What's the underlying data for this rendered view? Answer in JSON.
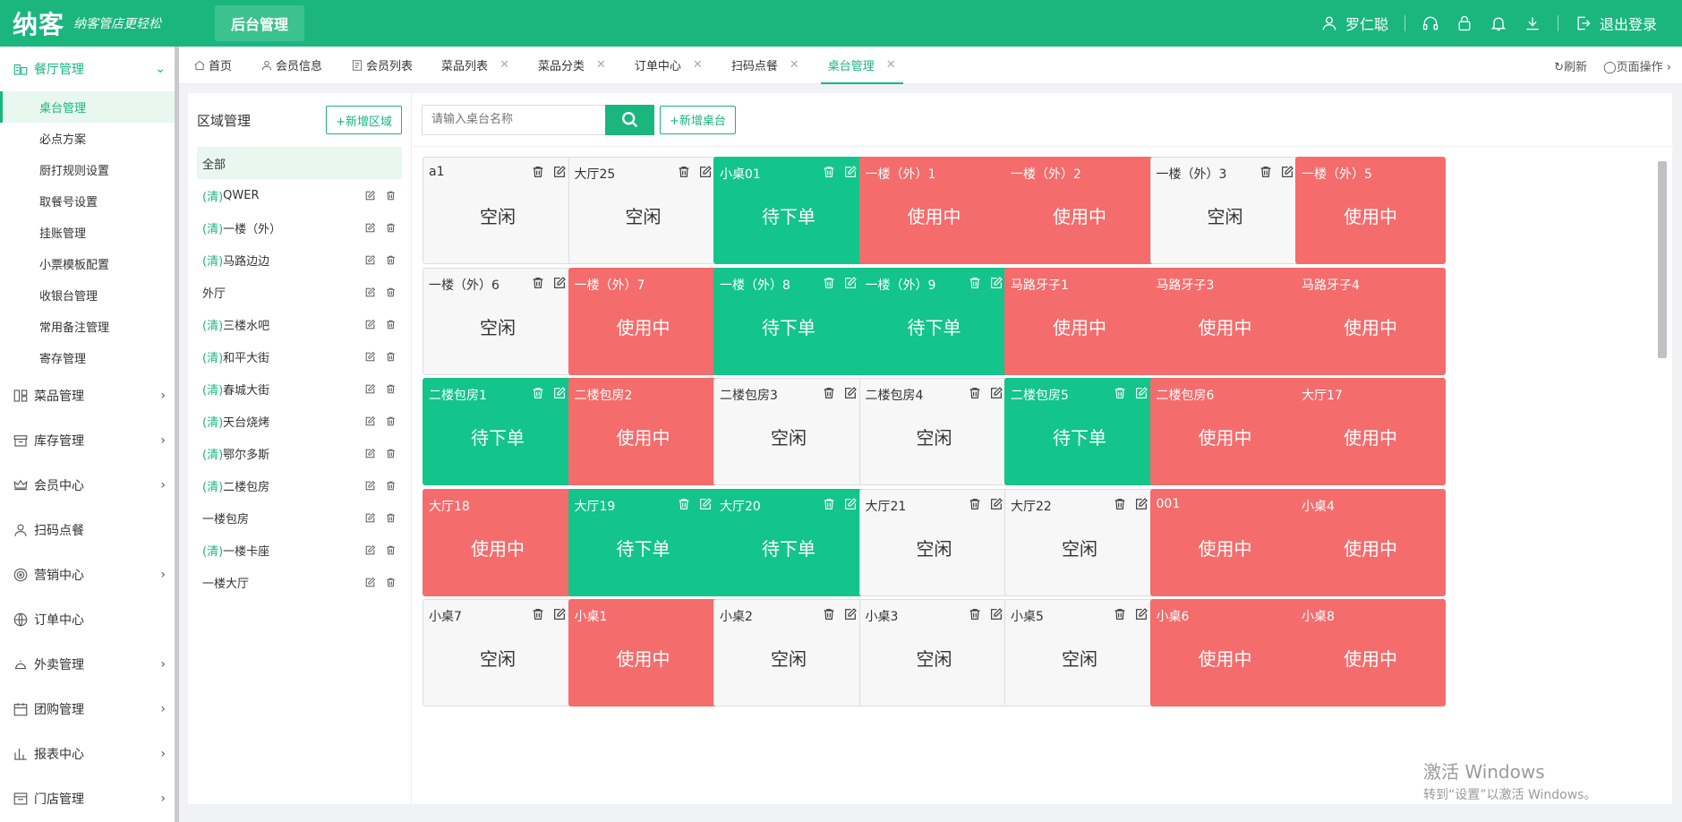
{
  "header": {
    "logo": "纳客",
    "slogan": "纳客管店更轻松",
    "active_tab": "后台管理",
    "user_name": "罗仁聪",
    "logout": "退出登录",
    "bg_color": "#1ab67e"
  },
  "sidebar": {
    "groups": [
      {
        "label": "餐厅管理",
        "icon": "restaurant-icon",
        "open": true
      },
      {
        "label": "菜品管理",
        "icon": "dish-icon"
      },
      {
        "label": "库存管理",
        "icon": "inventory-icon"
      },
      {
        "label": "会员中心",
        "icon": "crown-icon"
      },
      {
        "label": "扫码点餐",
        "icon": "user-icon"
      },
      {
        "label": "营销中心",
        "icon": "target-icon"
      },
      {
        "label": "订单中心",
        "icon": "globe-icon"
      },
      {
        "label": "外卖管理",
        "icon": "bell-service-icon"
      },
      {
        "label": "团购管理",
        "icon": "calendar-icon"
      },
      {
        "label": "报表中心",
        "icon": "bar-chart-icon"
      },
      {
        "label": "门店管理",
        "icon": "store-icon"
      }
    ],
    "sub_items": [
      "桌台管理",
      "必点方案",
      "厨打规则设置",
      "取餐号设置",
      "挂账管理",
      "小票模板配置",
      "收银台管理",
      "常用备注管理",
      "寄存管理"
    ]
  },
  "tabs": {
    "items": [
      "首页",
      "会员信息",
      "会员列表",
      "菜品列表",
      "菜品分类",
      "订单中心",
      "扫码点餐",
      "桌台管理"
    ],
    "refresh": "刷新",
    "page_ops": "页面操作"
  },
  "area": {
    "title": "区域管理",
    "add_button": "+新增区域",
    "items": [
      {
        "pre": "",
        "name": "全部"
      },
      {
        "pre": "(清)",
        "name": "QWER"
      },
      {
        "pre": "(清)",
        "name": "一楼（外）"
      },
      {
        "pre": "(清)",
        "name": "马路边边"
      },
      {
        "pre": "",
        "name": "外厅"
      },
      {
        "pre": "(清)",
        "name": "三楼水吧"
      },
      {
        "pre": "(清)",
        "name": "和平大街"
      },
      {
        "pre": "(清)",
        "name": "春城大街"
      },
      {
        "pre": "(清)",
        "name": "天台烧烤"
      },
      {
        "pre": "(清)",
        "name": "鄂尔多斯"
      },
      {
        "pre": "(清)",
        "name": "二楼包房"
      },
      {
        "pre": "",
        "name": "一楼包房"
      },
      {
        "pre": "(清)",
        "name": "一楼卡座"
      },
      {
        "pre": "",
        "name": "一楼大厅"
      }
    ]
  },
  "toolbar": {
    "search_placeholder": "请输入桌台名称",
    "add_table": "+新增桌台"
  },
  "status_labels": {
    "free": "空闲",
    "used": "使用中",
    "wait": "待下单"
  },
  "status_colors": {
    "free": "#f7f7f7",
    "used": "#f56c6c",
    "wait": "#13c48b"
  },
  "tables": [
    {
      "name": "a1",
      "status": "free",
      "ops": true
    },
    {
      "name": "大厅25",
      "status": "free",
      "ops": true
    },
    {
      "name": "小桌01",
      "status": "wait",
      "ops": true
    },
    {
      "name": "一楼（外）1",
      "status": "used",
      "ops": false
    },
    {
      "name": "一楼（外）2",
      "status": "used",
      "ops": false
    },
    {
      "name": "一楼（外）3",
      "status": "free",
      "ops": true
    },
    {
      "name": "一楼（外）5",
      "status": "used",
      "ops": false
    },
    {
      "name": "一楼（外）6",
      "status": "free",
      "ops": true
    },
    {
      "name": "一楼（外）7",
      "status": "used",
      "ops": false
    },
    {
      "name": "一楼（外）8",
      "status": "wait",
      "ops": true
    },
    {
      "name": "一楼（外）9",
      "status": "wait",
      "ops": true
    },
    {
      "name": "马路牙子1",
      "status": "used",
      "ops": false
    },
    {
      "name": "马路牙子3",
      "status": "used",
      "ops": false
    },
    {
      "name": "马路牙子4",
      "status": "used",
      "ops": false
    },
    {
      "name": "二楼包房1",
      "status": "wait",
      "ops": true
    },
    {
      "name": "二楼包房2",
      "status": "used",
      "ops": false
    },
    {
      "name": "二楼包房3",
      "status": "free",
      "ops": true
    },
    {
      "name": "二楼包房4",
      "status": "free",
      "ops": true
    },
    {
      "name": "二楼包房5",
      "status": "wait",
      "ops": true
    },
    {
      "name": "二楼包房6",
      "status": "used",
      "ops": false
    },
    {
      "name": "大厅17",
      "status": "used",
      "ops": false
    },
    {
      "name": "大厅18",
      "status": "used",
      "ops": false
    },
    {
      "name": "大厅19",
      "status": "wait",
      "ops": true
    },
    {
      "name": "大厅20",
      "status": "wait",
      "ops": true
    },
    {
      "name": "大厅21",
      "status": "free",
      "ops": true
    },
    {
      "name": "大厅22",
      "status": "free",
      "ops": true
    },
    {
      "name": "001",
      "status": "used",
      "ops": false
    },
    {
      "name": "小桌4",
      "status": "used",
      "ops": false
    },
    {
      "name": "小桌7",
      "status": "free",
      "ops": true
    },
    {
      "name": "小桌1",
      "status": "used",
      "ops": false
    },
    {
      "name": "小桌2",
      "status": "free",
      "ops": true
    },
    {
      "name": "小桌3",
      "status": "free",
      "ops": true
    },
    {
      "name": "小桌5",
      "status": "free",
      "ops": true
    },
    {
      "name": "小桌6",
      "status": "used",
      "ops": false
    },
    {
      "name": "小桌8",
      "status": "used",
      "ops": false
    }
  ],
  "watermark": {
    "line1": "激活 Windows",
    "line2": "转到“设置”以激活 Windows。"
  }
}
